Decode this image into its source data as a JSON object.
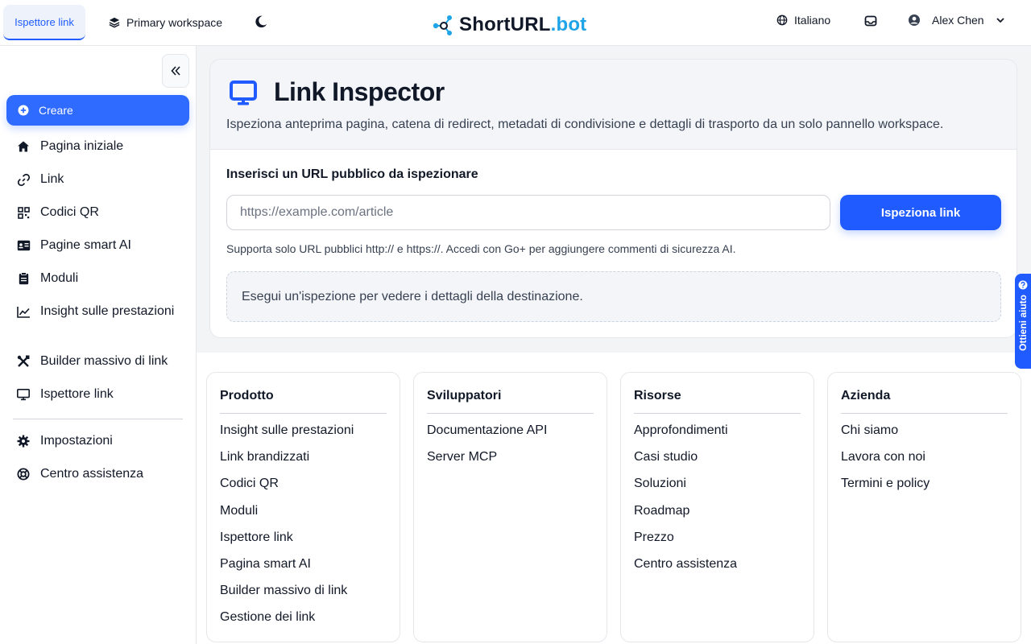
{
  "header": {
    "active_tab": "Ispettore link",
    "workspace": "Primary workspace",
    "brand_main": "ShortURL",
    "brand_suffix": ".bot",
    "language": "Italiano",
    "user_name": "Alex Chen",
    "accent": "#1f5bff"
  },
  "sidebar": {
    "create_label": "Creare",
    "items": [
      {
        "label": "Pagina iniziale",
        "icon": "home-icon"
      },
      {
        "label": "Link",
        "icon": "link-icon"
      },
      {
        "label": "Codici QR",
        "icon": "qr-code-icon"
      },
      {
        "label": "Pagine smart AI",
        "icon": "id-card-icon"
      },
      {
        "label": "Moduli",
        "icon": "clipboard-icon"
      },
      {
        "label": "Insight sulle prestazioni",
        "icon": "chart-line-icon"
      },
      {
        "label": "Builder massivo di link",
        "icon": "tools-icon"
      },
      {
        "label": "Ispettore link",
        "icon": "monitor-icon"
      }
    ],
    "bottom_items": [
      {
        "label": "Impostazioni",
        "icon": "gear-icon"
      },
      {
        "label": "Centro assistenza",
        "icon": "lifebuoy-icon"
      }
    ]
  },
  "main": {
    "title": "Link Inspector",
    "subtitle": "Ispeziona anteprima pagina, catena di redirect, metadati di condivisione e dettagli di trasporto da un solo pannello workspace.",
    "input_label": "Inserisci un URL pubblico da ispezionare",
    "input_value": "",
    "input_placeholder": "https://example.com/article",
    "button_label": "Ispeziona link",
    "hint": "Supporta solo URL pubblici http:// e https://. Accedi con Go+ per aggiungere commenti di sicurezza AI.",
    "result_text": "Esegui un'ispezione per vedere i dettagli della destinazione."
  },
  "help_tab": "Ottieni aiuto",
  "footer": [
    {
      "title": "Prodotto",
      "links": [
        "Insight sulle prestazioni",
        "Link brandizzati",
        "Codici QR",
        "Moduli",
        "Ispettore link",
        "Pagina smart AI",
        "Builder massivo di link",
        "Gestione dei link"
      ]
    },
    {
      "title": "Sviluppatori",
      "links": [
        "Documentazione API",
        "Server MCP"
      ]
    },
    {
      "title": "Risorse",
      "links": [
        "Approfondimenti",
        "Casi studio",
        "Soluzioni",
        "Roadmap",
        "Prezzo",
        "Centro assistenza"
      ]
    },
    {
      "title": "Azienda",
      "links": [
        "Chi siamo",
        "Lavora con noi",
        "Termini e policy"
      ]
    }
  ]
}
